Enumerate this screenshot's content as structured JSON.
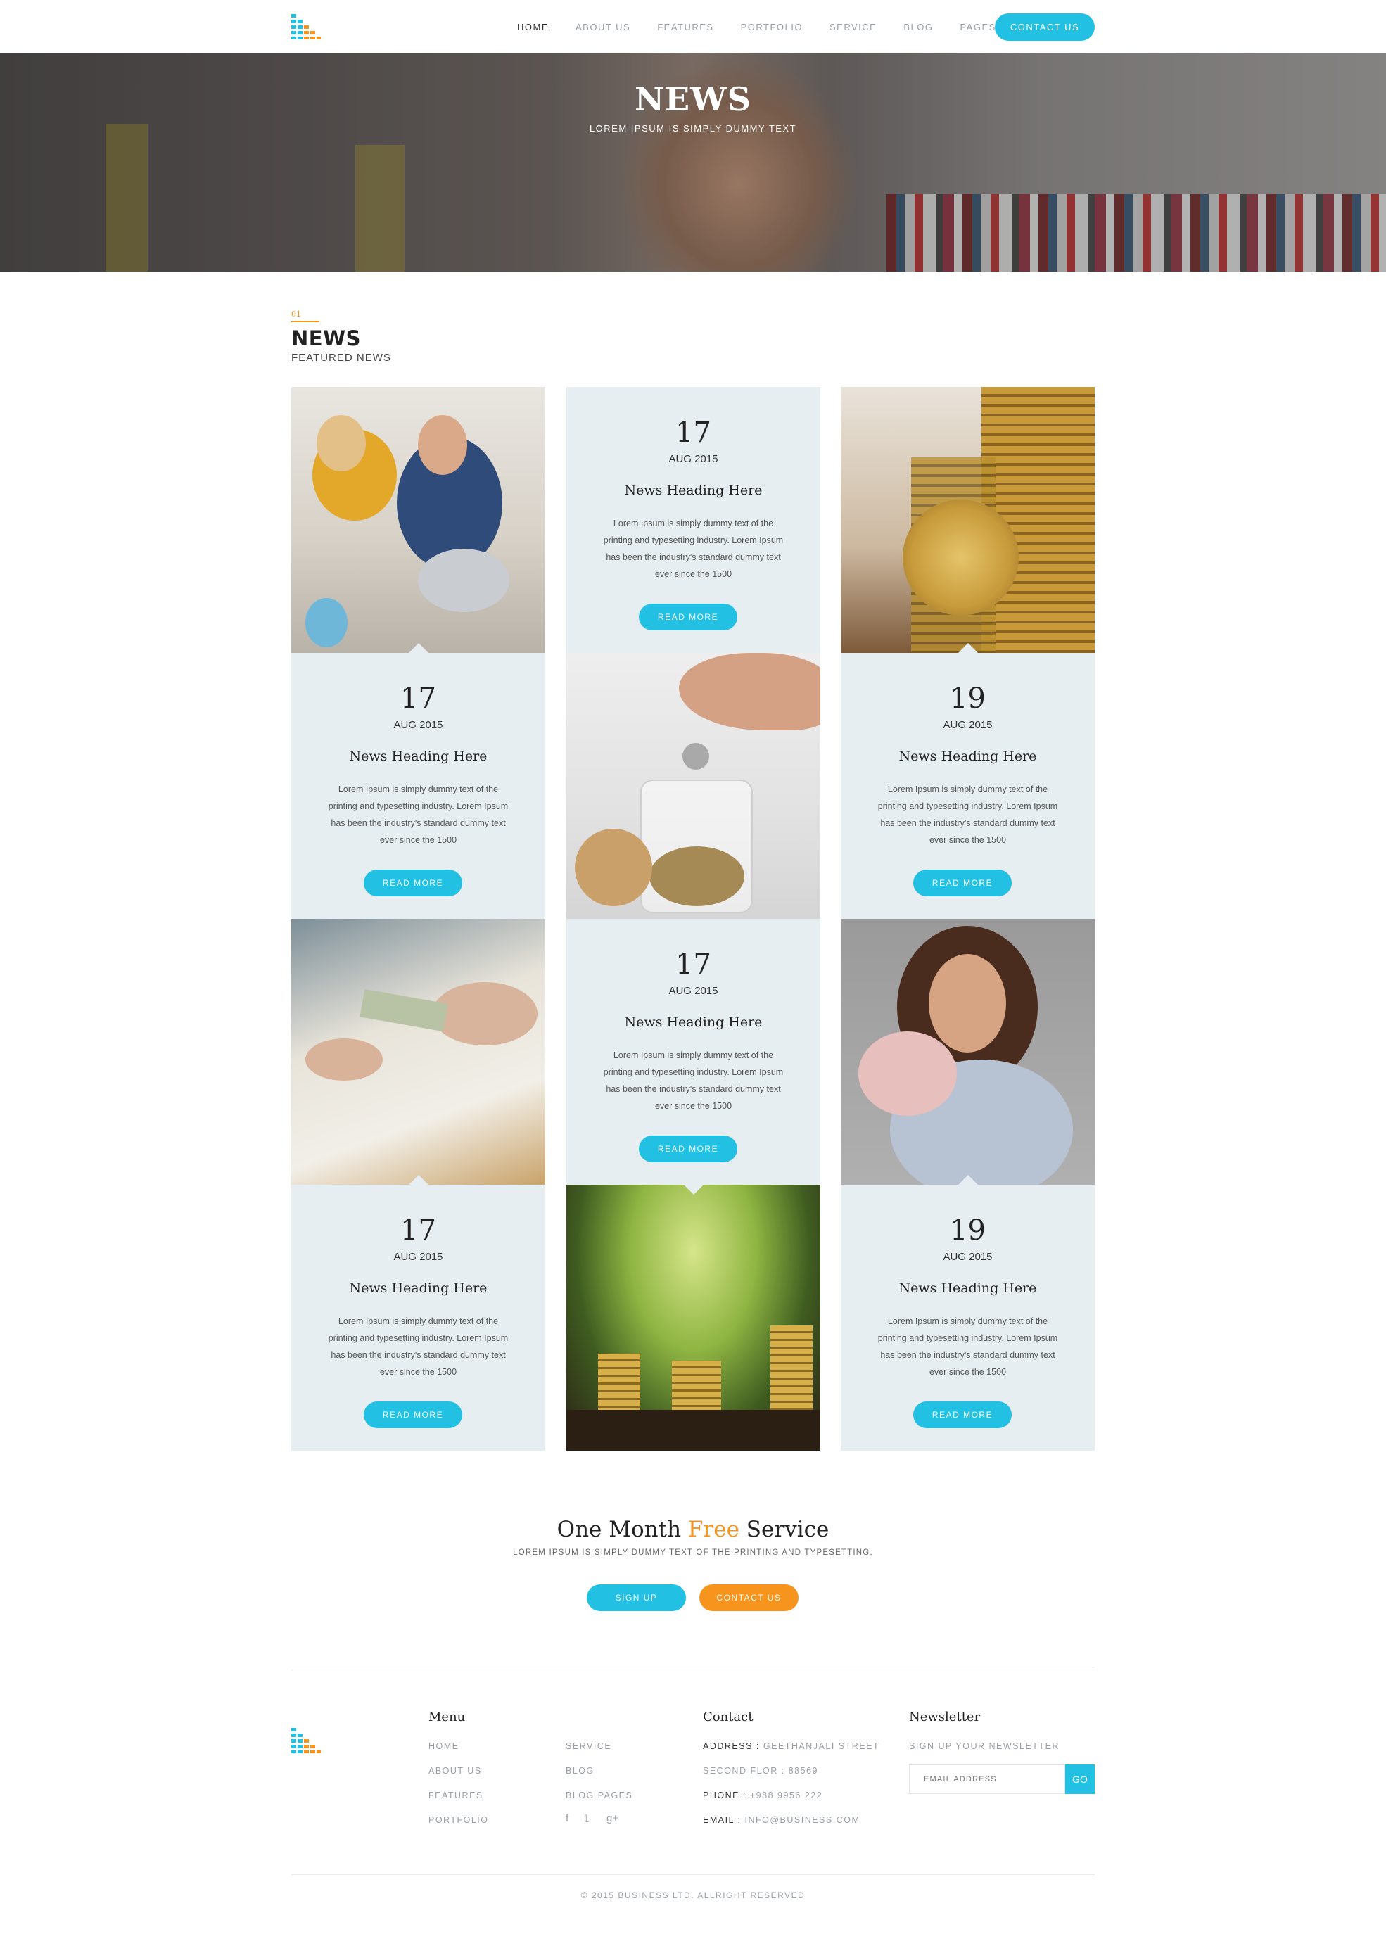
{
  "nav": {
    "items": [
      {
        "label": "HOME"
      },
      {
        "label": "ABOUT US"
      },
      {
        "label": "FEATURES"
      },
      {
        "label": "PORTFOLIO"
      },
      {
        "label": "SERVICE"
      },
      {
        "label": "BLOG"
      },
      {
        "label": "PAGES",
        "caret": "⌄"
      }
    ],
    "cta": "CONTACT US"
  },
  "hero": {
    "title": "NEWS",
    "subtitle": "LOREM IPSUM IS SIMPLY DUMMY TEXT"
  },
  "section": {
    "number": "01",
    "title": "NEWS",
    "subtitle": "FEATURED NEWS"
  },
  "news": [
    {
      "day": "17",
      "month": "AUG 2015",
      "heading": "News Heading Here",
      "body": "Lorem Ipsum is simply dummy text of the printing and typesetting industry. Lorem Ipsum has been the industry's standard dummy text ever since the 1500",
      "button": "READ MORE"
    },
    {
      "day": "17",
      "month": "AUG 2015",
      "heading": "News Heading Here",
      "body": "Lorem Ipsum is simply dummy text of the printing and typesetting industry. Lorem Ipsum has been the industry's standard dummy text ever since the 1500",
      "button": "READ MORE"
    },
    {
      "day": "19",
      "month": "AUG 2015",
      "heading": "News Heading Here",
      "body": "Lorem Ipsum is simply dummy text of the printing and typesetting industry. Lorem Ipsum has been the industry's standard dummy text ever since the 1500",
      "button": "READ MORE"
    },
    {
      "day": "17",
      "month": "AUG 2015",
      "heading": "News Heading Here",
      "body": "Lorem Ipsum is simply dummy text of the printing and typesetting industry. Lorem Ipsum has been the industry's standard dummy text ever since the 1500",
      "button": "READ MORE"
    },
    {
      "day": "17",
      "month": "AUG 2015",
      "heading": "News Heading Here",
      "body": "Lorem Ipsum is simply dummy text of the printing and typesetting industry. Lorem Ipsum has been the industry's standard dummy text ever since the 1500",
      "button": "READ MORE"
    },
    {
      "day": "19",
      "month": "AUG 2015",
      "heading": "News Heading Here",
      "body": "Lorem Ipsum is simply dummy text of the printing and typesetting industry. Lorem Ipsum has been the industry's standard dummy text ever since the 1500",
      "button": "READ MORE"
    }
  ],
  "cta": {
    "title_before": "One Month ",
    "title_accent": "Free",
    "title_after": " Service",
    "subtitle": "LOREM IPSUM IS SIMPLY DUMMY TEXT OF THE PRINTING AND TYPESETTING.",
    "signup": "SIGN UP",
    "contact": "CONTACT US"
  },
  "footer": {
    "menu_title": "Menu",
    "menu_col1": [
      "HOME",
      "ABOUT US",
      "FEATURES",
      "PORTFOLIO"
    ],
    "menu_col2": [
      "SERVICE",
      "BLOG",
      "BLOG PAGES"
    ],
    "social": [
      "f",
      "𝕥",
      "g+"
    ],
    "contact_title": "Contact",
    "contact": [
      {
        "label": "ADDRESS :",
        "value": " GEETHANJALI STREET"
      },
      {
        "label": "",
        "value": "SECOND FLOR : 88569"
      },
      {
        "label": "PHONE :",
        "value": " +988 9956 222"
      },
      {
        "label": "EMAIL :",
        "value": " INFO@BUSINESS.COM"
      }
    ],
    "newsletter_title": "Newsletter",
    "newsletter_sub": "SIGN UP YOUR NEWSLETTER",
    "newsletter_placeholder": "EMAIL ADDRESS",
    "newsletter_button": "GO",
    "copyright": "© 2015 BUSINESS LTD. ALLRIGHT RESERVED"
  },
  "colors": {
    "accent": "#22c0e3",
    "orange": "#f7941d",
    "card_bg": "#e6eef1"
  }
}
